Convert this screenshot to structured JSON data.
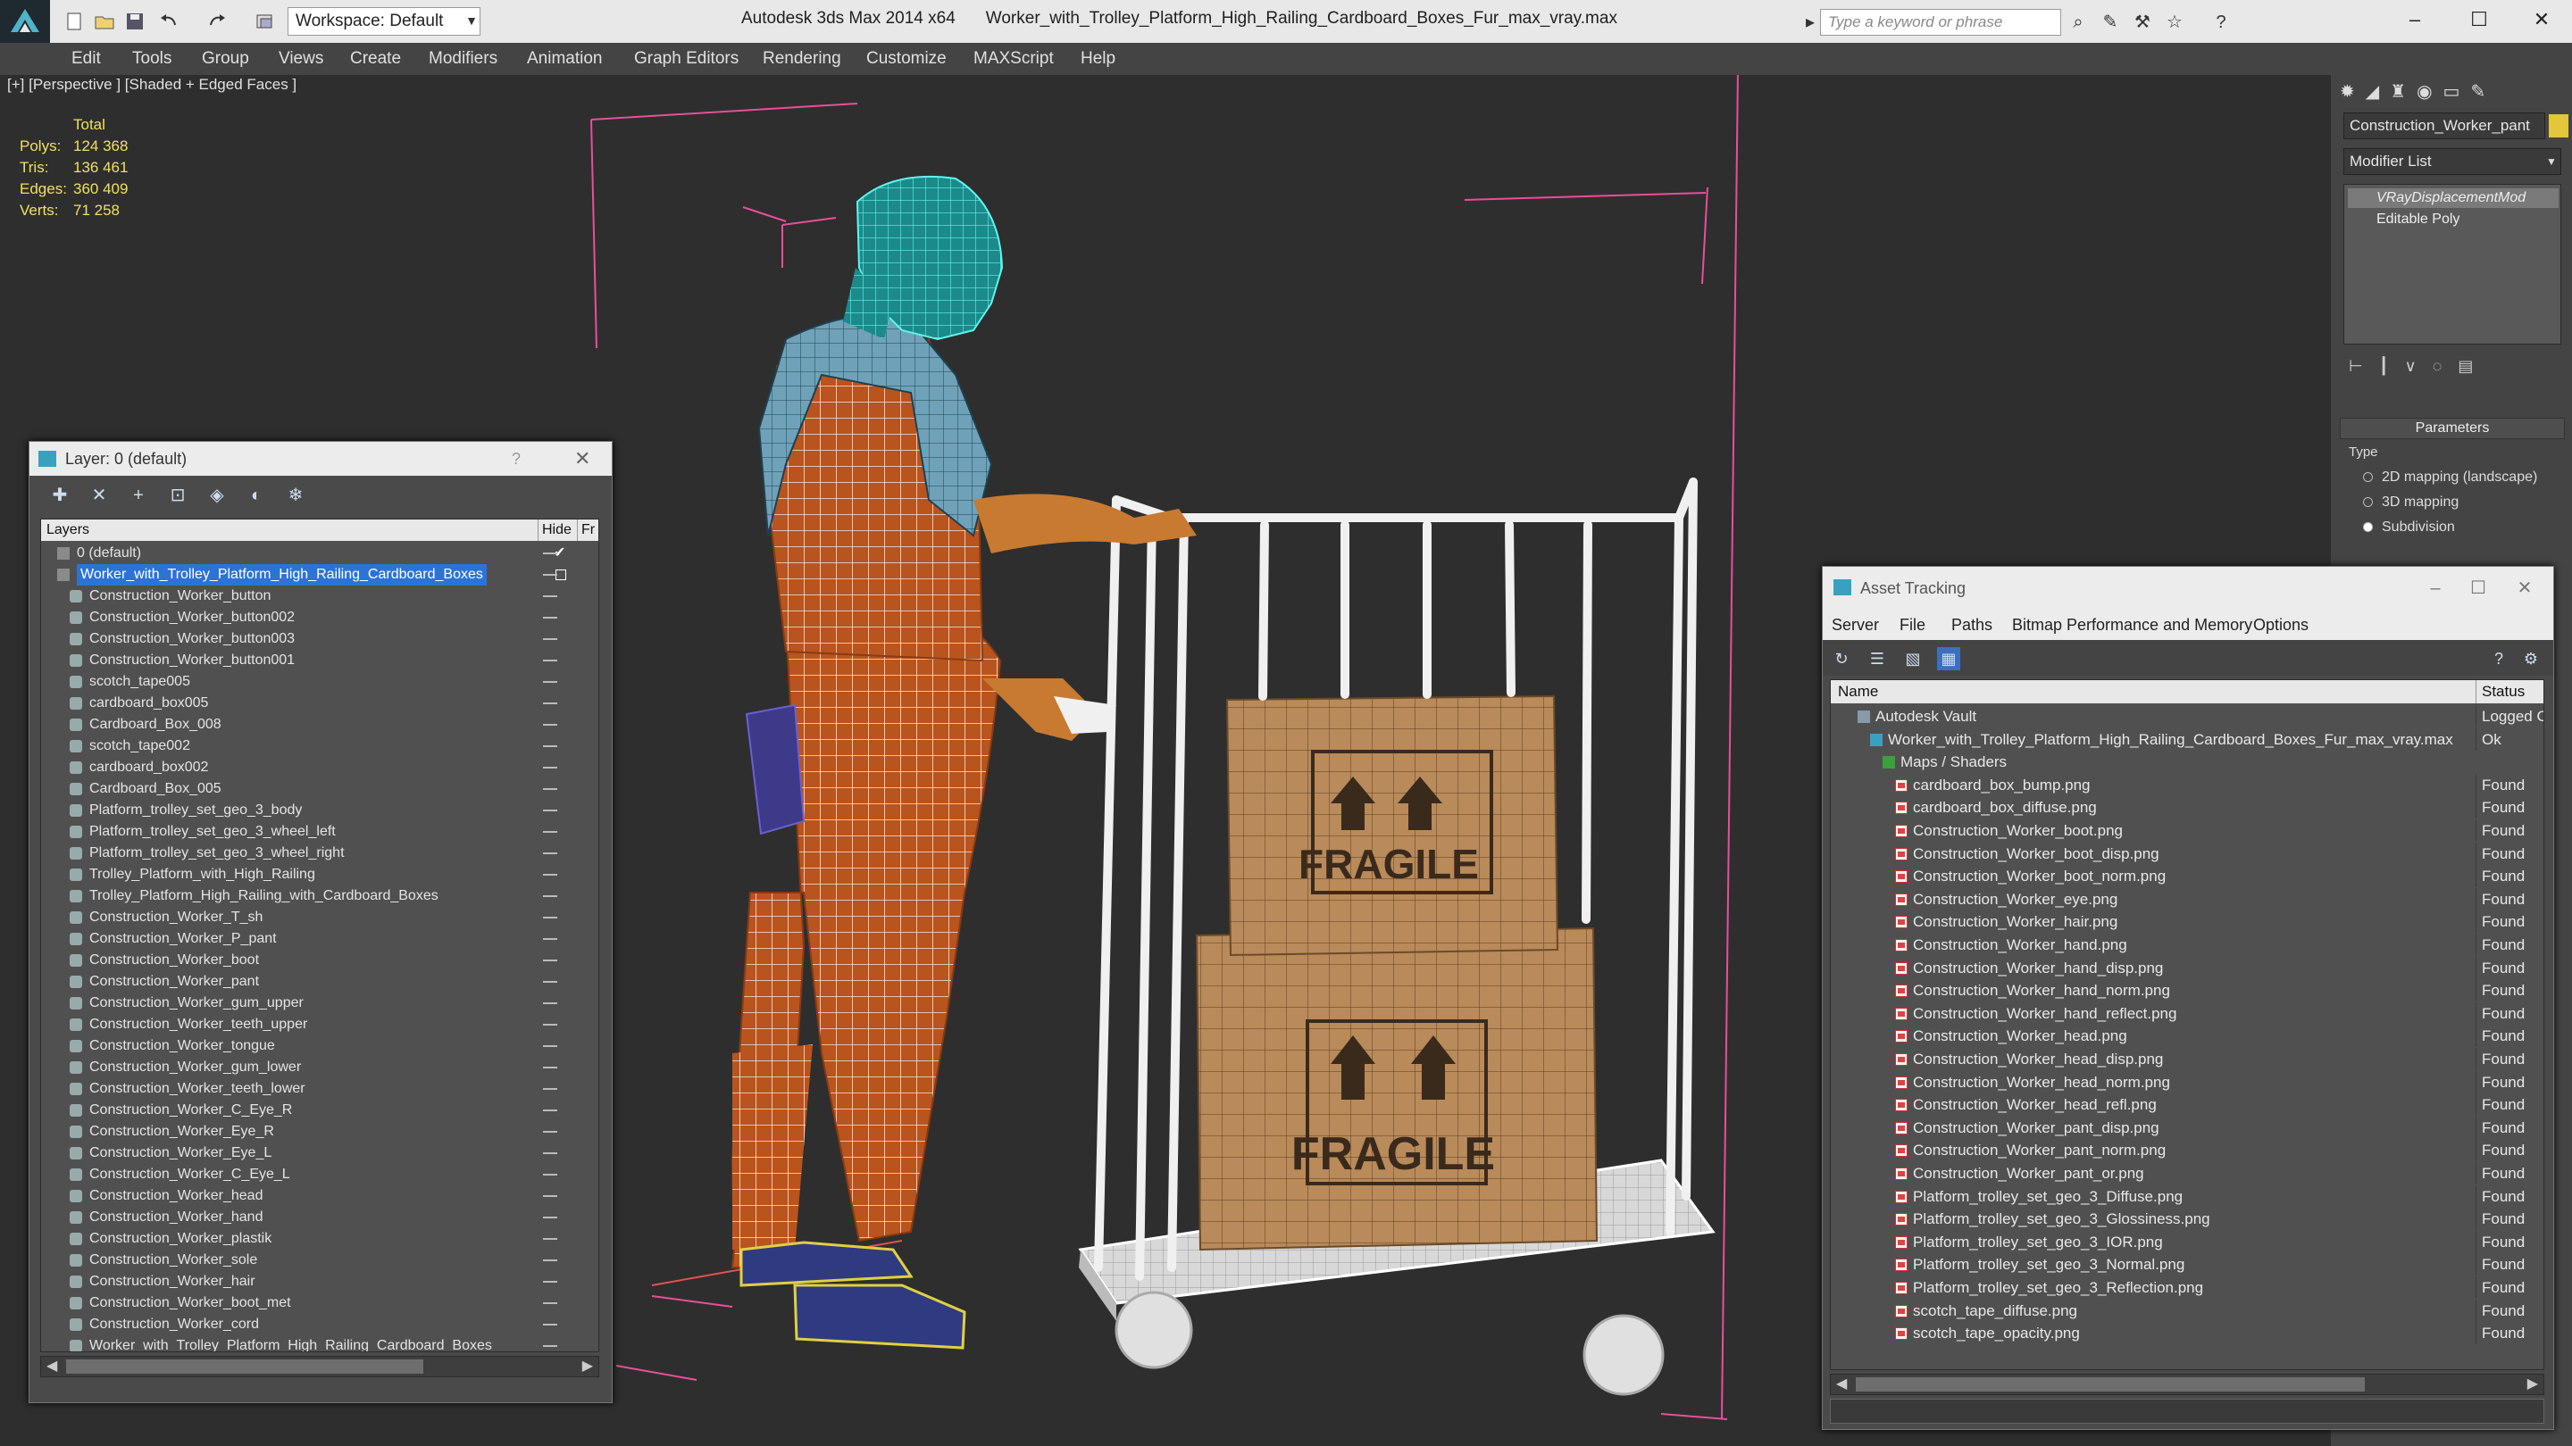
{
  "app": {
    "title": "Autodesk 3ds Max 2014 x64",
    "file": "Worker_with_Trolley_Platform_High_Railing_Cardboard_Boxes_Fur_max_vray.max",
    "workspace": "Workspace: Default",
    "search_placeholder": "Type a keyword or phrase",
    "window_minimize": "–",
    "window_maximize": "☐",
    "window_close": "✕"
  },
  "menu": [
    "Edit",
    "Tools",
    "Group",
    "Views",
    "Create",
    "Modifiers",
    "Animation",
    "Graph Editors",
    "Rendering",
    "Customize",
    "MAXScript",
    "Help"
  ],
  "viewport": {
    "label": "[+] [Perspective ] [Shaded + Edged Faces ]",
    "stats_header": "Total",
    "stats": [
      {
        "label": "Polys:",
        "value": "124 368"
      },
      {
        "label": "Tris:",
        "value": "136 461"
      },
      {
        "label": "Edges:",
        "value": "360 409"
      },
      {
        "label": "Verts:",
        "value": "71 258"
      }
    ],
    "box_text": "FRAGILE"
  },
  "command_panel": {
    "object_name": "Construction_Worker_pant",
    "object_color": "#e3c63a",
    "modifier_list": "Modifier List",
    "stack": [
      "VRayDisplacementMod",
      "Editable Poly"
    ],
    "parameters_title": "Parameters",
    "type_label": "Type",
    "mapping_options": [
      "2D mapping (landscape)",
      "3D mapping",
      "Subdivision"
    ],
    "selected_mapping": 2
  },
  "layer_dialog": {
    "title": "Layer: 0 (default)",
    "help": "?",
    "close": "✕",
    "columns": {
      "layers": "Layers",
      "hide": "Hide",
      "freeze": "Fr"
    },
    "layers": [
      {
        "name": "0 (default)",
        "level": 0,
        "checked": true
      },
      {
        "name": "Worker_with_Trolley_Platform_High_Railing_Cardboard_Boxes",
        "level": 0,
        "selected": true
      },
      {
        "name": "Construction_Worker_button",
        "level": 1
      },
      {
        "name": "Construction_Worker_button002",
        "level": 1
      },
      {
        "name": "Construction_Worker_button003",
        "level": 1
      },
      {
        "name": "Construction_Worker_button001",
        "level": 1
      },
      {
        "name": "scotch_tape005",
        "level": 1
      },
      {
        "name": "cardboard_box005",
        "level": 1
      },
      {
        "name": "Cardboard_Box_008",
        "level": 1
      },
      {
        "name": "scotch_tape002",
        "level": 1
      },
      {
        "name": "cardboard_box002",
        "level": 1
      },
      {
        "name": "Cardboard_Box_005",
        "level": 1
      },
      {
        "name": "Platform_trolley_set_geo_3_body",
        "level": 1
      },
      {
        "name": "Platform_trolley_set_geo_3_wheel_left",
        "level": 1
      },
      {
        "name": "Platform_trolley_set_geo_3_wheel_right",
        "level": 1
      },
      {
        "name": "Trolley_Platform_with_High_Railing",
        "level": 1
      },
      {
        "name": "Trolley_Platform_High_Railing_with_Cardboard_Boxes",
        "level": 1
      },
      {
        "name": "Construction_Worker_T_sh",
        "level": 1
      },
      {
        "name": "Construction_Worker_P_pant",
        "level": 1
      },
      {
        "name": "Construction_Worker_boot",
        "level": 1
      },
      {
        "name": "Construction_Worker_pant",
        "level": 1
      },
      {
        "name": "Construction_Worker_gum_upper",
        "level": 1
      },
      {
        "name": "Construction_Worker_teeth_upper",
        "level": 1
      },
      {
        "name": "Construction_Worker_tongue",
        "level": 1
      },
      {
        "name": "Construction_Worker_gum_lower",
        "level": 1
      },
      {
        "name": "Construction_Worker_teeth_lower",
        "level": 1
      },
      {
        "name": "Construction_Worker_C_Eye_R",
        "level": 1
      },
      {
        "name": "Construction_Worker_Eye_R",
        "level": 1
      },
      {
        "name": "Construction_Worker_Eye_L",
        "level": 1
      },
      {
        "name": "Construction_Worker_C_Eye_L",
        "level": 1
      },
      {
        "name": "Construction_Worker_head",
        "level": 1
      },
      {
        "name": "Construction_Worker_hand",
        "level": 1
      },
      {
        "name": "Construction_Worker_plastik",
        "level": 1
      },
      {
        "name": "Construction_Worker_sole",
        "level": 1
      },
      {
        "name": "Construction_Worker_hair",
        "level": 1
      },
      {
        "name": "Construction_Worker_boot_met",
        "level": 1
      },
      {
        "name": "Construction_Worker_cord",
        "level": 1
      },
      {
        "name": "Worker_with_Trolley_Platform_High_Railing_Cardboard_Boxes",
        "level": 1
      }
    ]
  },
  "asset_dialog": {
    "title": "Asset Tracking",
    "menu": [
      "Server",
      "File",
      "Paths",
      "Bitmap Performance and Memory",
      "Options"
    ],
    "columns": {
      "name": "Name",
      "status": "Status"
    },
    "rows": [
      {
        "name": "Autodesk Vault",
        "status": "Logged C",
        "level": 0,
        "kind": "vault"
      },
      {
        "name": "Worker_with_Trolley_Platform_High_Railing_Cardboard_Boxes_Fur_max_vray.max",
        "status": "Ok",
        "level": 1,
        "kind": "max"
      },
      {
        "name": "Maps / Shaders",
        "status": "",
        "level": 2,
        "kind": "folder"
      },
      {
        "name": "cardboard_box_bump.png",
        "status": "Found",
        "level": 3,
        "kind": "png"
      },
      {
        "name": "cardboard_box_diffuse.png",
        "status": "Found",
        "level": 3,
        "kind": "png"
      },
      {
        "name": "Construction_Worker_boot.png",
        "status": "Found",
        "level": 3,
        "kind": "png"
      },
      {
        "name": "Construction_Worker_boot_disp.png",
        "status": "Found",
        "level": 3,
        "kind": "png"
      },
      {
        "name": "Construction_Worker_boot_norm.png",
        "status": "Found",
        "level": 3,
        "kind": "png"
      },
      {
        "name": "Construction_Worker_eye.png",
        "status": "Found",
        "level": 3,
        "kind": "png"
      },
      {
        "name": "Construction_Worker_hair.png",
        "status": "Found",
        "level": 3,
        "kind": "png"
      },
      {
        "name": "Construction_Worker_hand.png",
        "status": "Found",
        "level": 3,
        "kind": "png"
      },
      {
        "name": "Construction_Worker_hand_disp.png",
        "status": "Found",
        "level": 3,
        "kind": "png"
      },
      {
        "name": "Construction_Worker_hand_norm.png",
        "status": "Found",
        "level": 3,
        "kind": "png"
      },
      {
        "name": "Construction_Worker_hand_reflect.png",
        "status": "Found",
        "level": 3,
        "kind": "png"
      },
      {
        "name": "Construction_Worker_head.png",
        "status": "Found",
        "level": 3,
        "kind": "png"
      },
      {
        "name": "Construction_Worker_head_disp.png",
        "status": "Found",
        "level": 3,
        "kind": "png"
      },
      {
        "name": "Construction_Worker_head_norm.png",
        "status": "Found",
        "level": 3,
        "kind": "png"
      },
      {
        "name": "Construction_Worker_head_refl.png",
        "status": "Found",
        "level": 3,
        "kind": "png"
      },
      {
        "name": "Construction_Worker_pant_disp.png",
        "status": "Found",
        "level": 3,
        "kind": "png"
      },
      {
        "name": "Construction_Worker_pant_norm.png",
        "status": "Found",
        "level": 3,
        "kind": "png"
      },
      {
        "name": "Construction_Worker_pant_or.png",
        "status": "Found",
        "level": 3,
        "kind": "png"
      },
      {
        "name": "Platform_trolley_set_geo_3_Diffuse.png",
        "status": "Found",
        "level": 3,
        "kind": "png"
      },
      {
        "name": "Platform_trolley_set_geo_3_Glossiness.png",
        "status": "Found",
        "level": 3,
        "kind": "png"
      },
      {
        "name": "Platform_trolley_set_geo_3_IOR.png",
        "status": "Found",
        "level": 3,
        "kind": "png"
      },
      {
        "name": "Platform_trolley_set_geo_3_Normal.png",
        "status": "Found",
        "level": 3,
        "kind": "png"
      },
      {
        "name": "Platform_trolley_set_geo_3_Reflection.png",
        "status": "Found",
        "level": 3,
        "kind": "png"
      },
      {
        "name": "scotch_tape_diffuse.png",
        "status": "Found",
        "level": 3,
        "kind": "png"
      },
      {
        "name": "scotch_tape_opacity.png",
        "status": "Found",
        "level": 3,
        "kind": "png"
      }
    ]
  }
}
